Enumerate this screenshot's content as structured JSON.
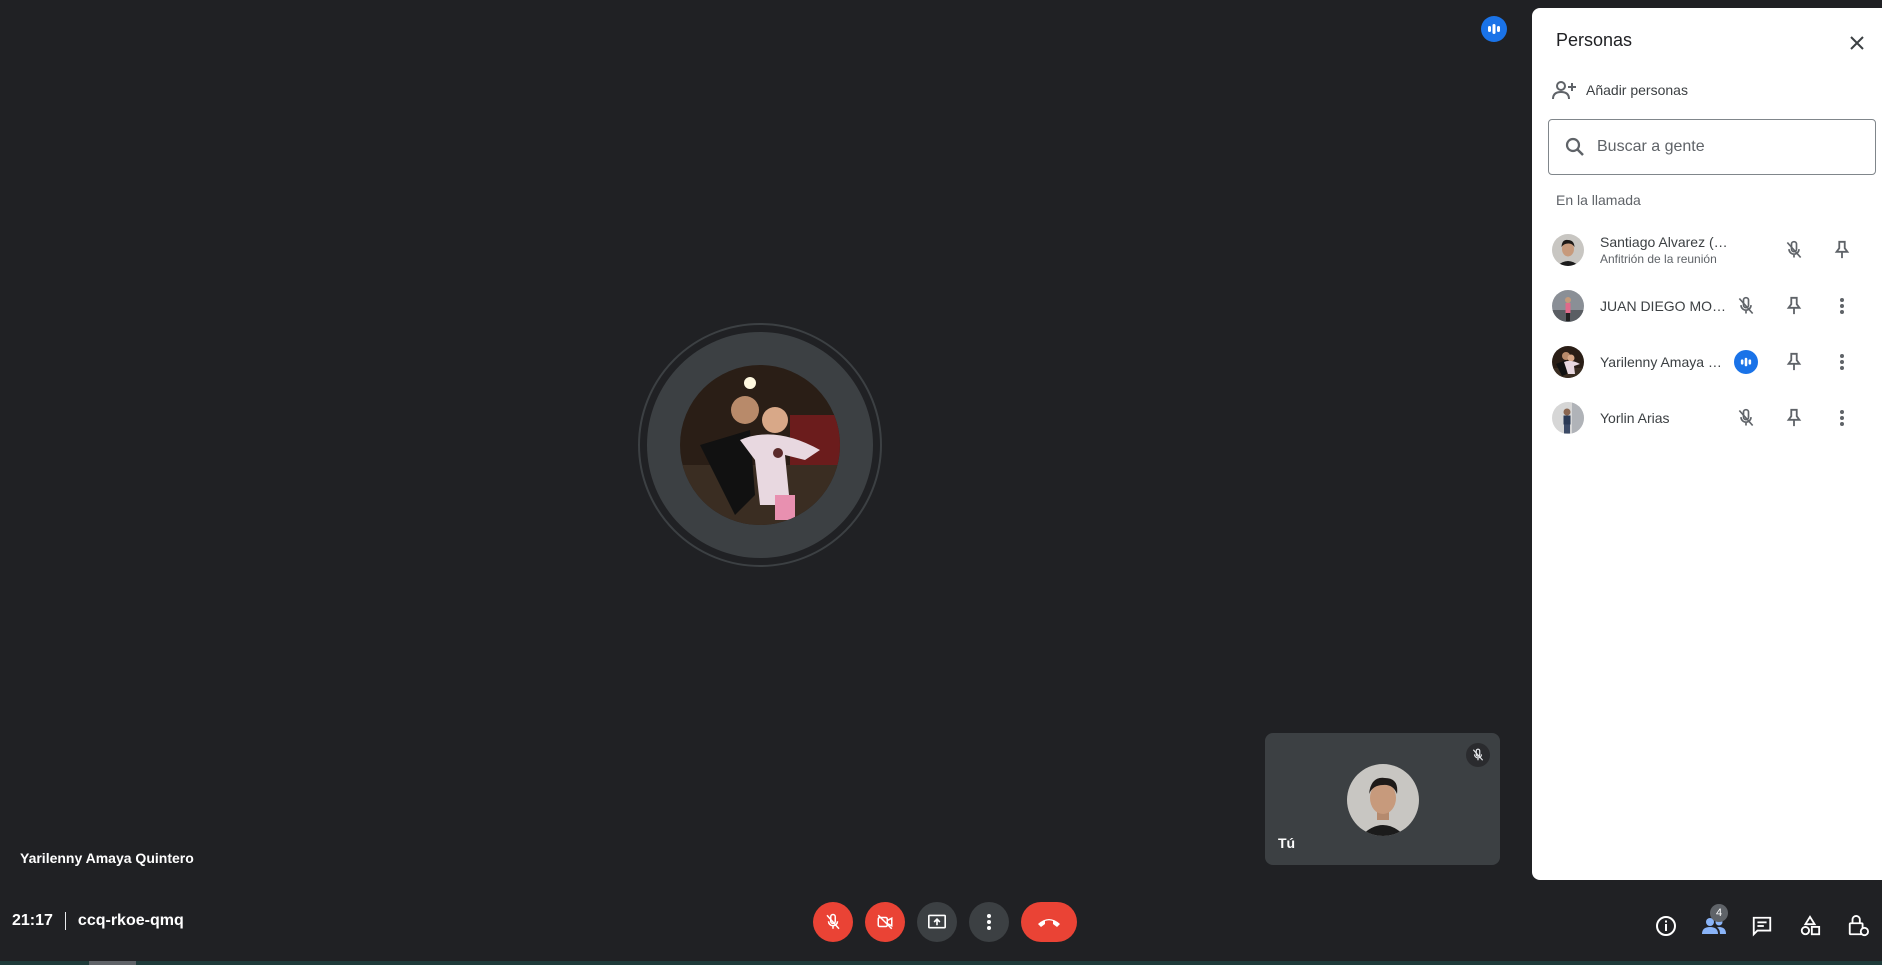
{
  "stage": {
    "speaker_name": "Yarilenny Amaya Quintero",
    "self_label": "Tú"
  },
  "bottom_bar": {
    "time": "21:17",
    "meeting_code": "ccq-rkoe-qmq",
    "people_count": "4"
  },
  "panel": {
    "title": "Personas",
    "add_people_label": "Añadir personas",
    "search_placeholder": "Buscar a gente",
    "section_label": "En la llamada",
    "participants": [
      {
        "name": "Santiago Alvarez (Tú)",
        "subtitle": "Anfitrión de la reunión",
        "mic": "muted"
      },
      {
        "name": "JUAN DIEGO MOR...",
        "subtitle": "",
        "mic": "muted"
      },
      {
        "name": "Yarilenny Amaya Q...",
        "subtitle": "",
        "mic": "speaking"
      },
      {
        "name": "Yorlin Arias",
        "subtitle": "",
        "mic": "muted"
      }
    ]
  },
  "colors": {
    "background": "#202124",
    "accent_blue": "#1a73e8",
    "danger_red": "#ea4335",
    "tile_grey": "#3c4043"
  }
}
